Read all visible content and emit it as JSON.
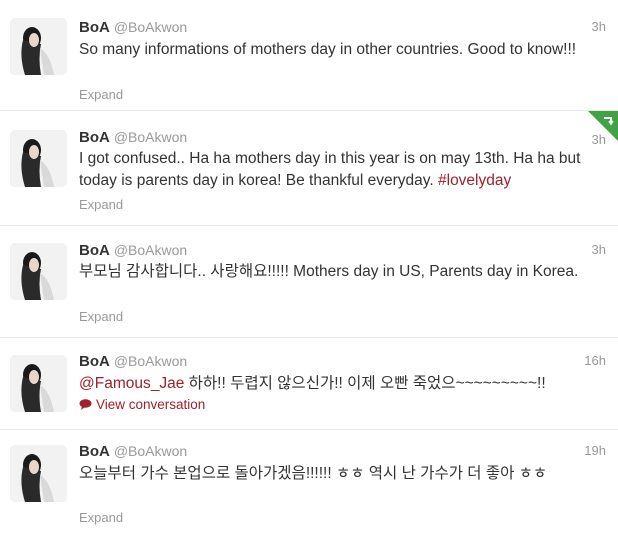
{
  "colors": {
    "text": "#333333",
    "muted": "#999999",
    "link": "#a0202b",
    "retweet_badge": "#3fa243",
    "divider": "#e8e8e8"
  },
  "tweets": [
    {
      "name": "BoA",
      "handle": "@BoAkwon",
      "time": "3h",
      "text": "So many informations of mothers day in other countries. Good to know!!!",
      "action": "Expand",
      "avatar_icon": "profile-photo"
    },
    {
      "name": "BoA",
      "handle": "@BoAkwon",
      "time": "3h",
      "text": "I got confused.. Ha ha mothers day in this year is on may 13th. Ha ha but today is parents day in korea! Be thankful everyday. ",
      "hashtag": "#lovelyday",
      "action": "Expand",
      "avatar_icon": "profile-photo",
      "badge_icon": "retweet-corner-icon"
    },
    {
      "name": "BoA",
      "handle": "@BoAkwon",
      "time": "3h",
      "text": "부모님 감사합니다.. 사랑해요!!!!! Mothers day in US, Parents day in Korea.",
      "action": "Expand",
      "avatar_icon": "profile-photo"
    },
    {
      "name": "BoA",
      "handle": "@BoAkwon",
      "time": "16h",
      "mention": "@Famous_Jae",
      "text": " 하하!! 두렵지 않으신가!! 이제 오빤 죽었으~~~~~~~~~!!",
      "action": "View conversation",
      "action_icon": "speech-bubble-icon",
      "avatar_icon": "profile-photo"
    },
    {
      "name": "BoA",
      "handle": "@BoAkwon",
      "time": "19h",
      "text": "오늘부터 가수 본업으로 돌아가겠음!!!!!! ㅎㅎ 역시 난 가수가 더 좋아 ㅎㅎ",
      "action": "Expand",
      "avatar_icon": "profile-photo"
    }
  ]
}
